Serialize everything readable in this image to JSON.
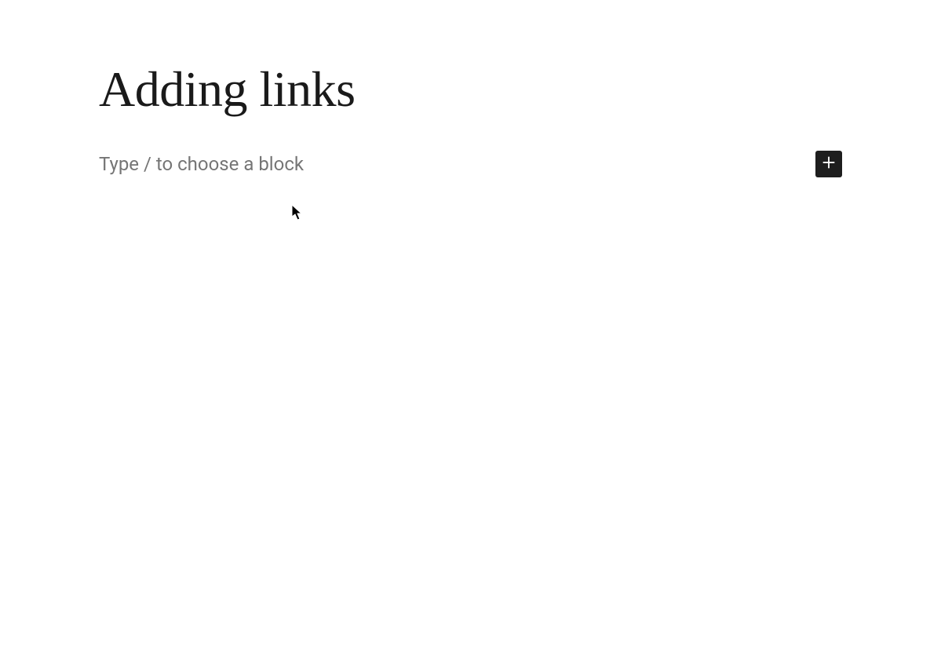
{
  "editor": {
    "title": "Adding links",
    "placeholder": "Type / to choose a block",
    "add_block_icon": "plus-icon"
  }
}
